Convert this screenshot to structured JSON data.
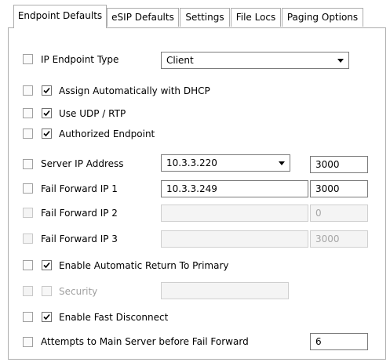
{
  "tabs": [
    {
      "label": "Endpoint Defaults",
      "active": true
    },
    {
      "label": "eSIP Defaults",
      "active": false
    },
    {
      "label": "Settings",
      "active": false
    },
    {
      "label": "File Locs",
      "active": false
    },
    {
      "label": "Paging Options",
      "active": false
    }
  ],
  "rows": {
    "ip_endpoint_type": {
      "label": "IP Endpoint Type",
      "value": "Client"
    },
    "assign_dhcp": {
      "label": "Assign Automatically with DHCP",
      "checked": true
    },
    "use_udp": {
      "label": "Use UDP / RTP",
      "checked": true
    },
    "authorized": {
      "label": "Authorized Endpoint",
      "checked": true
    },
    "server_ip": {
      "label": "Server IP Address",
      "value": "10.3.3.220",
      "port": "3000"
    },
    "fail_forward_1": {
      "label": "Fail Forward IP 1",
      "value": "10.3.3.249",
      "port": "3000"
    },
    "fail_forward_2": {
      "label": "Fail Forward IP 2",
      "value": "",
      "port": "0"
    },
    "fail_forward_3": {
      "label": "Fail Forward IP 3",
      "value": "",
      "port": "3000"
    },
    "auto_return": {
      "label": "Enable Automatic Return To Primary",
      "checked": true
    },
    "security": {
      "label": "Security",
      "checked": false,
      "value": ""
    },
    "fast_disconnect": {
      "label": "Enable Fast Disconnect",
      "checked": true
    },
    "attempts": {
      "label": "Attempts to Main Server before Fail Forward",
      "value": "6"
    }
  },
  "colors": {
    "border": "#adadad",
    "field_border": "#7a7a7a",
    "disabled_text": "#a0a0a0"
  }
}
